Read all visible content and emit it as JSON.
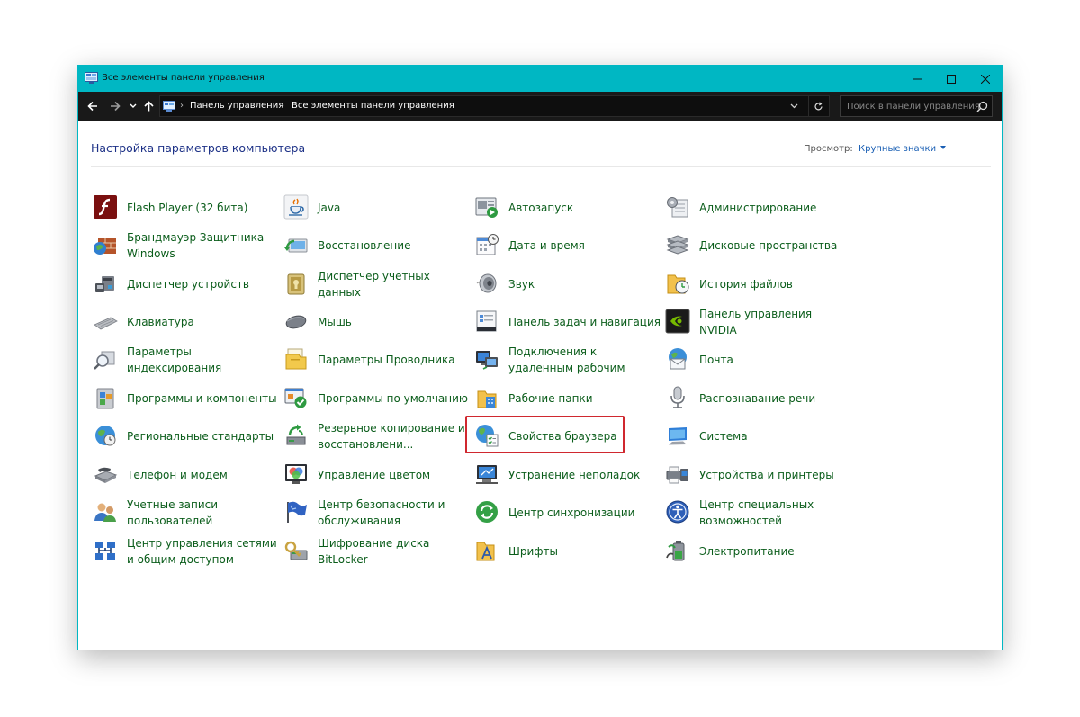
{
  "window": {
    "title": "Все элементы панели управления",
    "accent_color": "#00b7c3",
    "controls": [
      "minimize-icon",
      "maximize-icon",
      "close-icon"
    ]
  },
  "nav": {
    "breadcrumb": [
      "Панель управления",
      "Все элементы панели управления"
    ],
    "search_placeholder": "Поиск в панели управления"
  },
  "content": {
    "heading": "Настройка параметров компьютера",
    "view_label": "Просмотр:",
    "view_value": "Крупные значки",
    "link_color": "#0b5d1b",
    "highlight_color": "#d0282f",
    "highlighted_item": "Свойства браузера"
  },
  "items": [
    [
      "Flash Player (32 бита)",
      "Java",
      "Автозапуск",
      "Администрирование"
    ],
    [
      "Брандмауэр Защитника Windows",
      "Восстановление",
      "Дата и время",
      "Дисковые пространства"
    ],
    [
      "Диспетчер устройств",
      "Диспетчер учетных данных",
      "Звук",
      "История файлов"
    ],
    [
      "Клавиатура",
      "Мышь",
      "Панель задач и навигация",
      "Панель управления NVIDIA"
    ],
    [
      "Параметры индексирования",
      "Параметры Проводника",
      "Подключения к удаленным рабочим",
      "Почта"
    ],
    [
      "Программы и компоненты",
      "Программы по умолчанию",
      "Рабочие папки",
      "Распознавание речи"
    ],
    [
      "Региональные стандарты",
      "Резервное копирование и восстановлени...",
      "Свойства браузера",
      "Система"
    ],
    [
      "Телефон и модем",
      "Управление цветом",
      "Устранение неполадок",
      "Устройства и принтеры"
    ],
    [
      "Учетные записи пользователей",
      "Центр безопасности и обслуживания",
      "Центр синхронизации",
      "Центр специальных возможностей"
    ],
    [
      "Центр управления сетями и общим доступом",
      "Шифрование диска BitLocker",
      "Шрифты",
      "Электропитание"
    ]
  ]
}
